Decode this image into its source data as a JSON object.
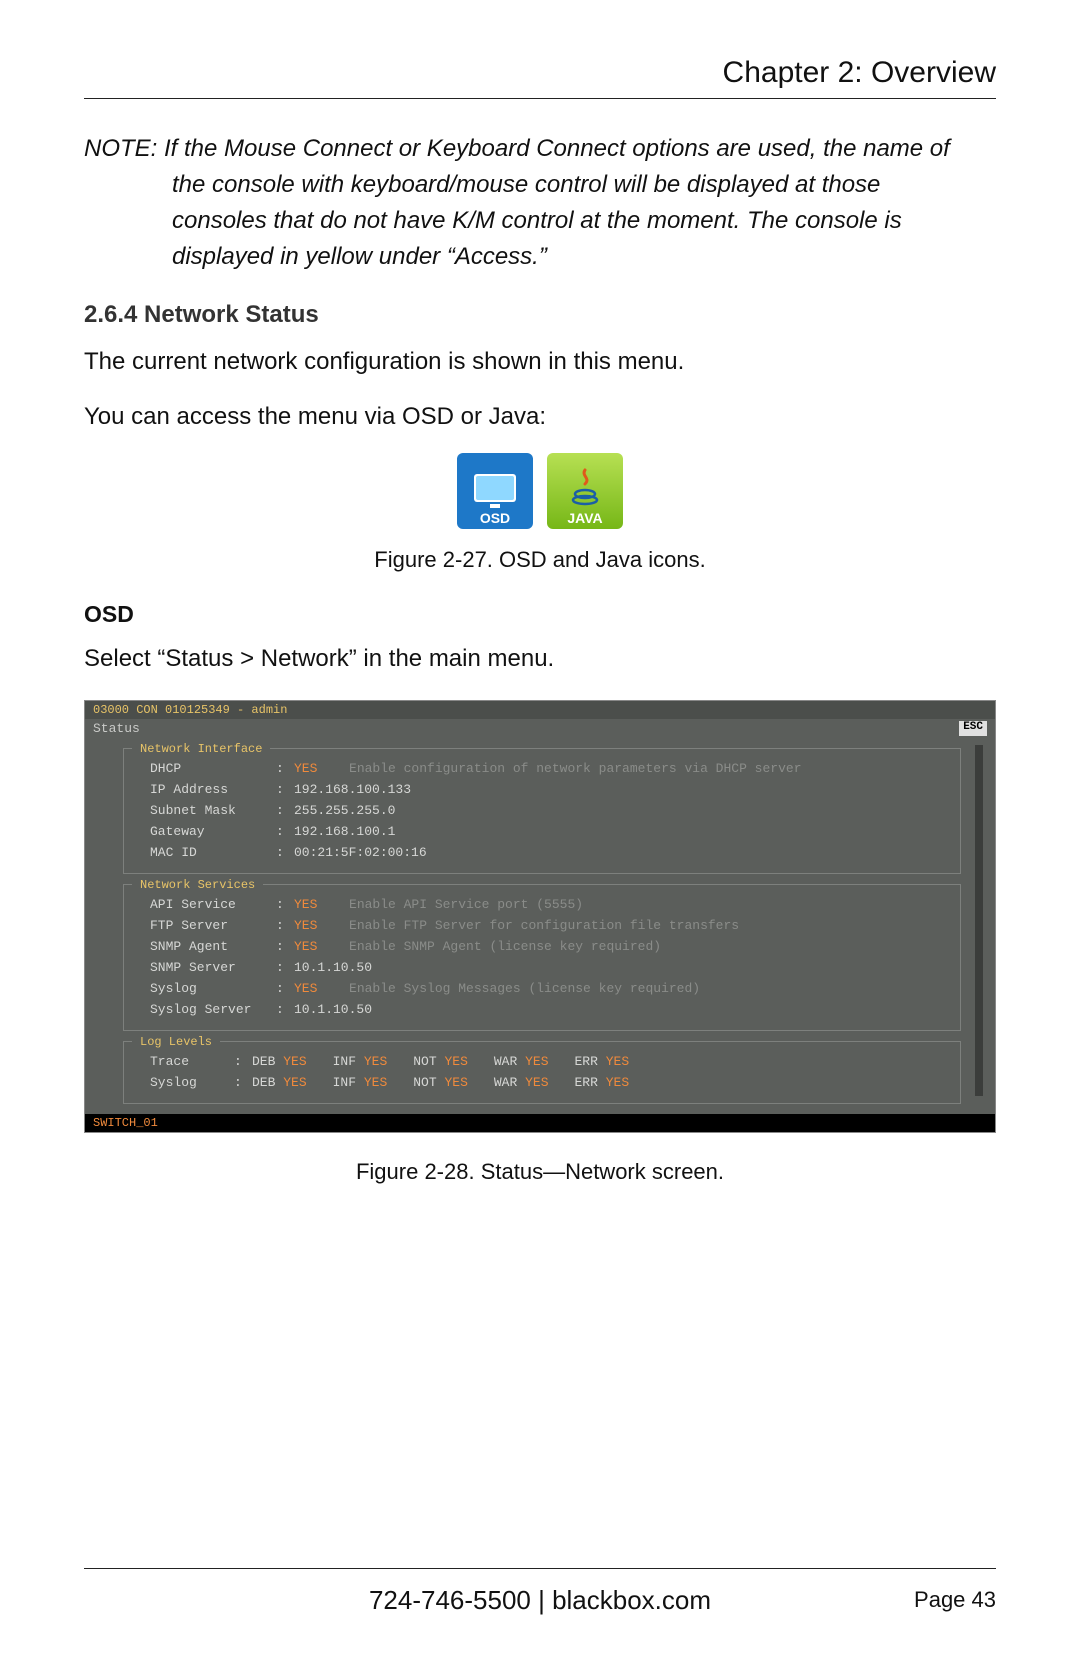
{
  "header": {
    "chapter": "Chapter 2: Overview"
  },
  "note": {
    "line1": "NOTE: If the Mouse Connect or Keyboard Connect options are used, the name of",
    "line2": "the console with keyboard/mouse control will be displayed at those",
    "line3": "consoles that do not have K/M control at the moment. The console is",
    "line4": "displayed in yellow under “Access.”"
  },
  "section": {
    "number_title": "2.6.4 Network Status",
    "p1": "The current network configuration is shown in this menu.",
    "p2": "You can access the menu via OSD or Java:"
  },
  "icons": {
    "osd_label": "OSD",
    "java_label": "JAVA"
  },
  "fig27": "Figure 2-27. OSD and Java icons.",
  "osd": {
    "heading": "OSD",
    "instruction": "Select “Status > Network” in the main menu."
  },
  "term": {
    "title": "03000 CON 010125349 - admin",
    "status_left": "Status",
    "esc": "ESC",
    "panel1": {
      "title": "Network Interface",
      "rows": [
        {
          "label": "DHCP",
          "flag": "YES",
          "desc": "Enable configuration of network parameters via DHCP server"
        },
        {
          "label": "IP Address",
          "value": "192.168.100.133"
        },
        {
          "label": "Subnet Mask",
          "value": "255.255.255.0"
        },
        {
          "label": "Gateway",
          "value": "192.168.100.1"
        },
        {
          "label": "MAC ID",
          "value": "00:21:5F:02:00:16"
        }
      ]
    },
    "panel2": {
      "title": "Network Services",
      "rows": [
        {
          "label": "API Service",
          "flag": "YES",
          "desc": "Enable API Service port (5555)"
        },
        {
          "label": "FTP Server",
          "flag": "YES",
          "desc": "Enable FTP Server for configuration file transfers"
        },
        {
          "label": "SNMP Agent",
          "flag": "YES",
          "desc": "Enable SNMP Agent (license key required)"
        },
        {
          "label": "SNMP Server",
          "value": "10.1.10.50"
        },
        {
          "label": "Syslog",
          "flag": "YES",
          "desc": "Enable Syslog Messages (license key required)"
        },
        {
          "label": "Syslog Server",
          "value": "10.1.10.50"
        }
      ]
    },
    "panel3": {
      "title": "Log Levels",
      "rows": [
        {
          "label": "Trace",
          "levels": [
            {
              "k": "DEB",
              "v": "YES"
            },
            {
              "k": "INF",
              "v": "YES"
            },
            {
              "k": "NOT",
              "v": "YES"
            },
            {
              "k": "WAR",
              "v": "YES"
            },
            {
              "k": "ERR",
              "v": "YES"
            }
          ]
        },
        {
          "label": "Syslog",
          "levels": [
            {
              "k": "DEB",
              "v": "YES"
            },
            {
              "k": "INF",
              "v": "YES"
            },
            {
              "k": "NOT",
              "v": "YES"
            },
            {
              "k": "WAR",
              "v": "YES"
            },
            {
              "k": "ERR",
              "v": "YES"
            }
          ]
        }
      ]
    },
    "footer": "SWITCH_01"
  },
  "fig28": "Figure 2-28. Status—Network screen.",
  "footer": {
    "center": "724-746-5500   |   blackbox.com",
    "right": "Page 43"
  }
}
